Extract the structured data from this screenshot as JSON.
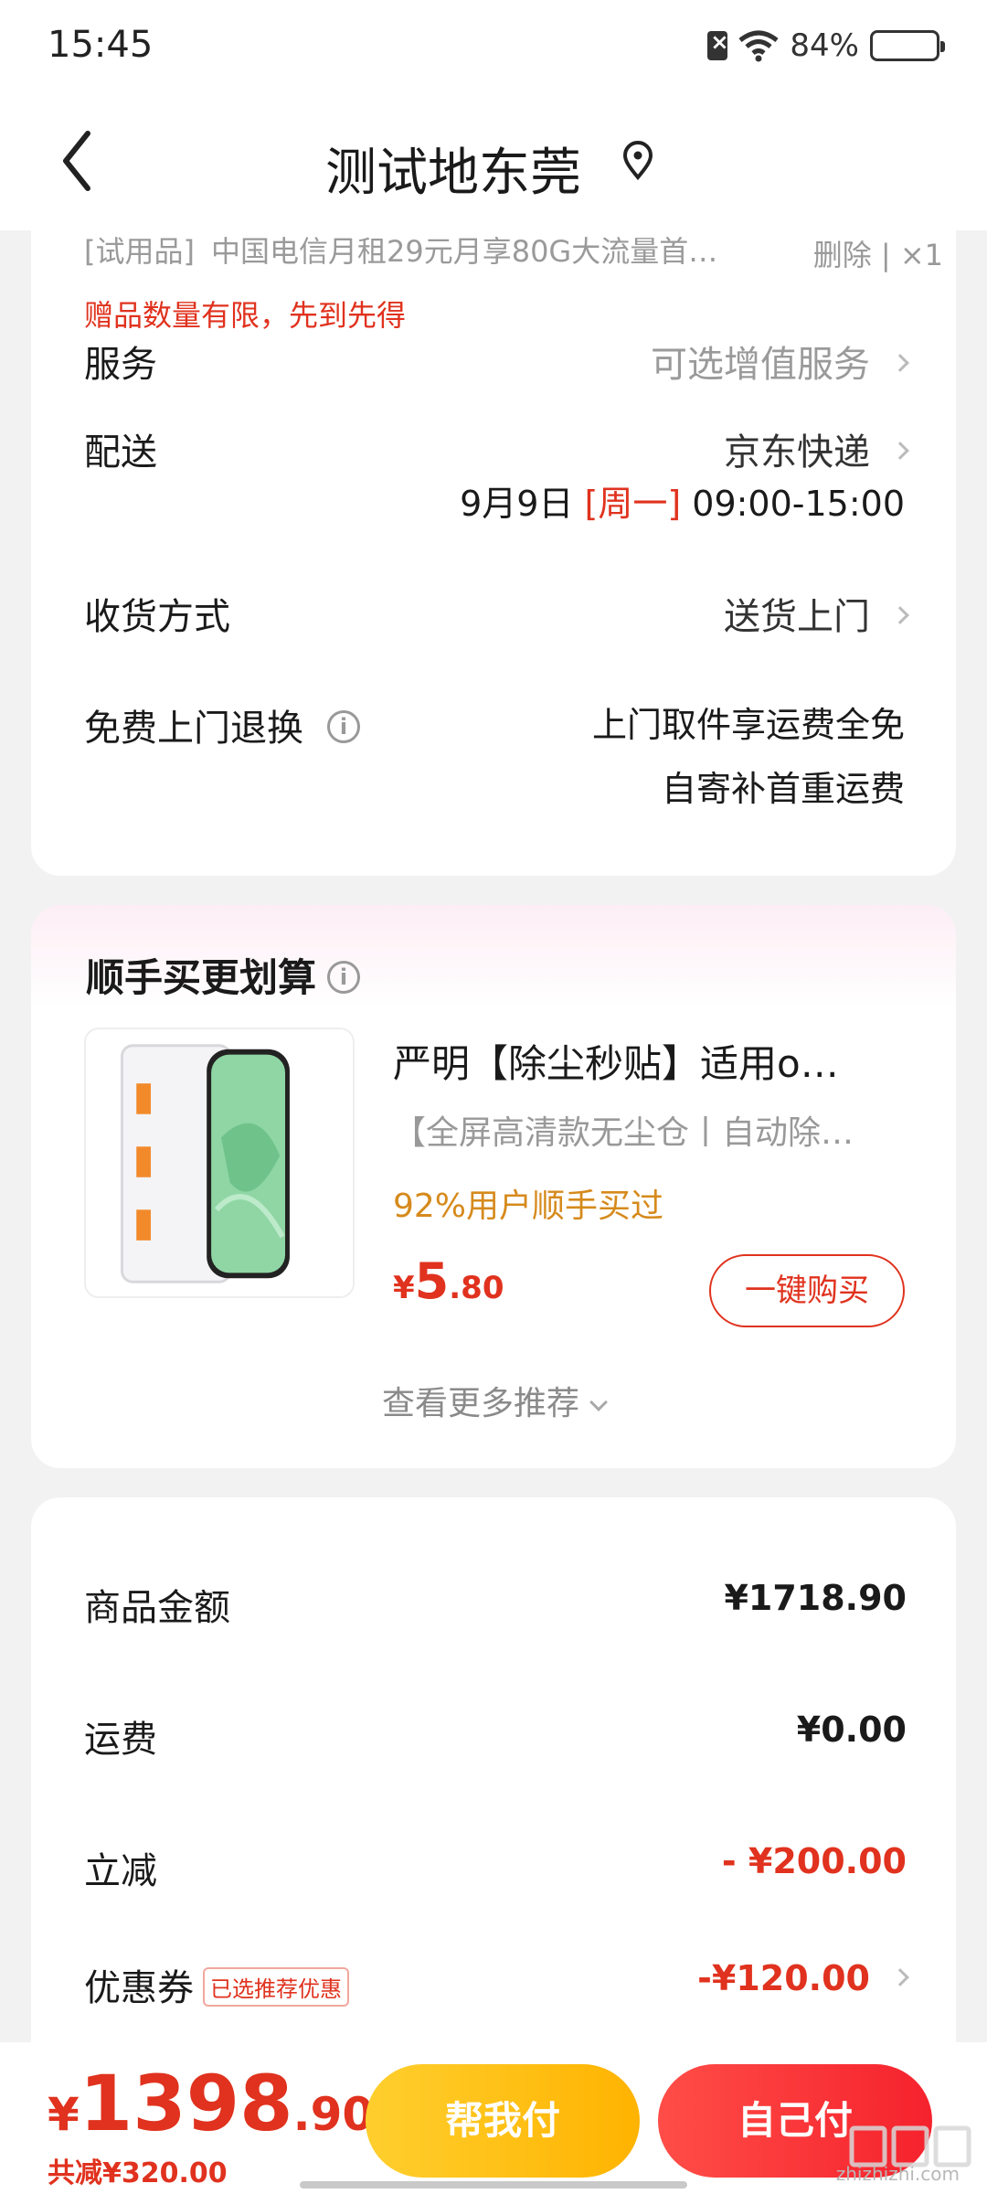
{
  "status_bar": {
    "time": "15:45",
    "battery_pct": "84%",
    "battery_level": 0.84
  },
  "header": {
    "title": "测试地东莞"
  },
  "trial_item": {
    "tag": "[试用品]",
    "text": "中国电信月租29元月享80G大流量首…",
    "delete_label": "删除",
    "qty": "×1",
    "note": "赠品数量有限，先到先得"
  },
  "order": {
    "service": {
      "label": "服务",
      "value": "可选增值服务"
    },
    "delivery": {
      "label": "配送",
      "value": "京东快递",
      "date": "9月9日",
      "weekday": "[周一]",
      "time": "09:00-15:00"
    },
    "receive": {
      "label": "收货方式",
      "value": "送货上门"
    },
    "return": {
      "label": "免费上门退换",
      "line1": "上门取件享运费全免",
      "line2": "自寄补首重运费"
    }
  },
  "recommend": {
    "title": "顺手买更划算",
    "product": {
      "name": "严明【除尘秒贴】适用o…",
      "desc": "【全屏高清款无尘仓丨自动除…",
      "bought": "92%用户顺手买过",
      "price_currency": "¥",
      "price_int": "5",
      "price_dec": ".80",
      "buy_label": "一键购买"
    },
    "more_label": "查看更多推荐"
  },
  "summary": {
    "goods": {
      "label": "商品金额",
      "value": "¥1718.90"
    },
    "shipping": {
      "label": "运费",
      "value": "¥0.00"
    },
    "discount": {
      "label": "立减",
      "value": "- ¥200.00"
    },
    "coupon": {
      "label": "优惠券",
      "tag": "已选推荐优惠",
      "value": "-¥120.00"
    }
  },
  "bottom": {
    "total_currency": "¥",
    "total_int": "1398",
    "total_dec": ".90",
    "saved": "共减¥320.00",
    "help_pay": "帮我付",
    "self_pay": "自己付"
  },
  "watermark": {
    "text": "zhizhizhi.com"
  },
  "colors": {
    "accent_red": "#e0321e",
    "gold": "#d68a1c",
    "yellow_btn": "#ffb300",
    "red_btn": "#f5222d"
  }
}
